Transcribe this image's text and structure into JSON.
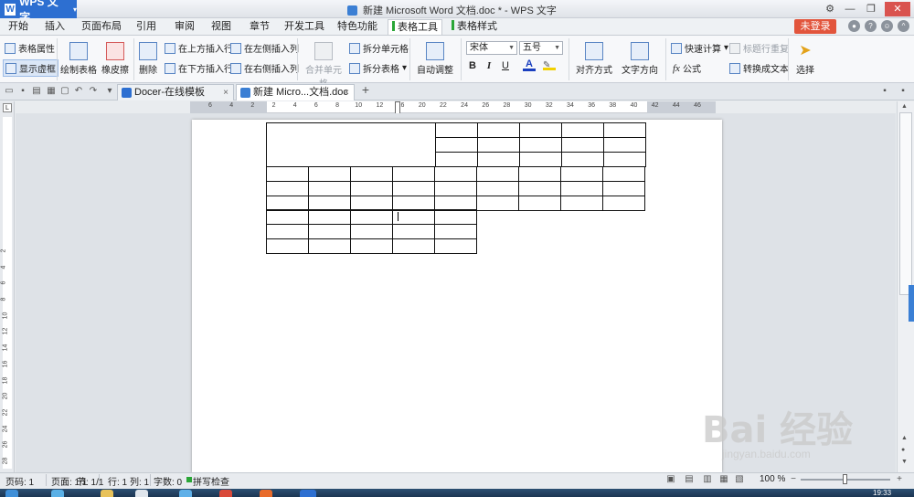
{
  "app": {
    "name": "WPS 文字",
    "doc_title": "新建 Microsoft Word 文档.doc * - WPS 文字"
  },
  "menu": {
    "tabs": [
      "开始",
      "插入",
      "页面布局",
      "引用",
      "审阅",
      "视图",
      "章节",
      "开发工具",
      "特色功能",
      "表格工具",
      "表格样式"
    ],
    "active": "表格工具",
    "login": "未登录"
  },
  "ribbon": {
    "table_props": "表格属性",
    "show_gridlines": "显示虚框",
    "draw_table": "绘制表格",
    "eraser": "橡皮擦",
    "delete": "删除",
    "insert_above": "在上方插入行",
    "insert_below": "在下方插入行",
    "insert_left": "在左侧插入列",
    "insert_right": "在右侧插入列",
    "merge_cells": "合并单元格",
    "split_cells": "拆分单元格",
    "split_table": "拆分表格",
    "auto_fit": "自动调整",
    "font_name": "宋体",
    "font_size": "五号",
    "bold": "B",
    "italic": "I",
    "underline": "U",
    "font_color": "A",
    "align": "对齐方式",
    "text_direction": "文字方向",
    "quick_calc": "快速计算",
    "repeat_header": "标题行重复",
    "formula": "公式",
    "convert_text": "转换成文本",
    "select": "选择"
  },
  "doc_tabs": [
    {
      "label": "Docer-在线模板",
      "active": false
    },
    {
      "label": "新建 Micro...文档.doc *",
      "active": true
    }
  ],
  "ruler": {
    "h_labels": [
      "6",
      "4",
      "2",
      "2",
      "4",
      "6",
      "8",
      "10",
      "12",
      "16",
      "20",
      "22",
      "24",
      "26",
      "28",
      "30",
      "32",
      "34",
      "36",
      "38",
      "40",
      "42",
      "44",
      "46"
    ],
    "v_labels": [
      "2",
      "4",
      "6",
      "8",
      "10",
      "12",
      "14",
      "16",
      "18",
      "20",
      "22",
      "24",
      "26",
      "28"
    ]
  },
  "table": {
    "top_right_rows": 3,
    "top_right_cols": 5,
    "middle_rows": 3,
    "middle_cols": 9,
    "bottom_rows": 3,
    "bottom_cols": 5
  },
  "status": {
    "page": "页码: 1",
    "pages": "页面: 1/1",
    "section": "节: 1/1",
    "row": "行: 1",
    "col": "列: 1",
    "words": "字数: 0",
    "spell": "拼写检查",
    "zoom": "100 %"
  },
  "taskbar": {
    "time": "19:33"
  },
  "watermark": {
    "brand": "Bai 经验",
    "url": "jingyan.baidu.com"
  },
  "colors": {
    "accent": "#2d6fd1",
    "login": "#e2553c",
    "active_tab_bar": "#2aa637"
  }
}
